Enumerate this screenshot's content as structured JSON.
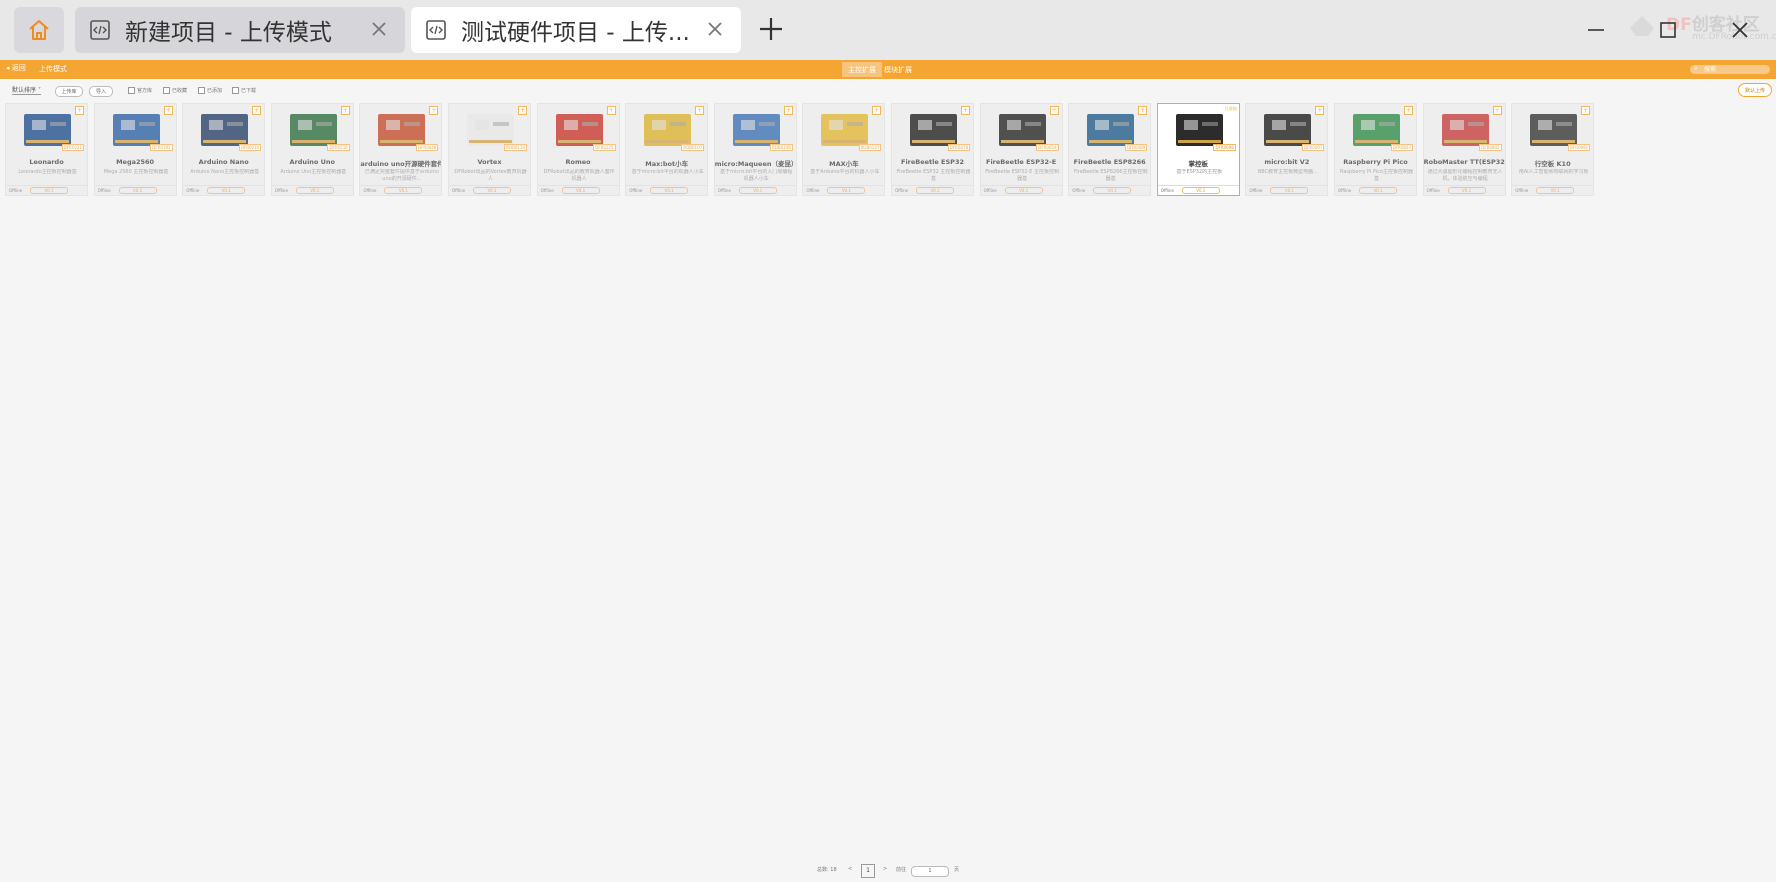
{
  "tabs": [
    {
      "label": "新建项目 - 上传模式"
    },
    {
      "label": "测试硬件项目 - 上传..."
    }
  ],
  "logo": {
    "text_df": "DF",
    "text_cn": "创客社区",
    "sub": "mc.DFRobot.com.cn"
  },
  "toolbar": {
    "back": "返回",
    "title": "上传模式",
    "tab_main": "主控扩展",
    "tab_sub": "模块扩展",
    "search_placeholder": "搜索",
    "sort_label": "默认排序",
    "btn_upload": "上传库",
    "btn_import": "导入",
    "filters": [
      "官方库",
      "已收藏",
      "已添加",
      "已下载"
    ],
    "default_upload": "默认上传"
  },
  "cards": [
    {
      "name": "Leonardo",
      "desc": "Leonardo主控板控制器基",
      "sku": "DFR0221",
      "offline": "Offline",
      "ver": "V0.1"
    },
    {
      "name": "Mega2560",
      "desc": "Mega 2560 主控板控制器基",
      "sku": "DFR0191",
      "offline": "Offline",
      "ver": "V0.1"
    },
    {
      "name": "Arduino Nano",
      "desc": "Arduino Nano主控板控制器基",
      "sku": "DFR0010",
      "offline": "Offline",
      "ver": "V0.1"
    },
    {
      "name": "Arduino Uno",
      "desc": "Arduino Uno主控板控制器基",
      "sku": "DFR0216",
      "offline": "Offline",
      "ver": "V0.1"
    },
    {
      "name": "arduino uno开源硬件套件",
      "desc": "已满足完整套件提供基于arduino uno的开源硬件...",
      "sku": "DFR0448",
      "offline": "Offline",
      "ver": "V0.1"
    },
    {
      "name": "Vortex",
      "desc": "DFRobot出品的Vortex教育机器人",
      "sku": "ROB0110",
      "offline": "Offline",
      "ver": "V0.1"
    },
    {
      "name": "Romeo",
      "desc": "DFRobot出品的教育机器人套件机器人",
      "sku": "DFR0225",
      "offline": "Offline",
      "ver": "V0.1"
    },
    {
      "name": "Max:bot小车",
      "desc": "基于micro:bit平台的机器人小车",
      "sku": "ROB0107",
      "offline": "Offline",
      "ver": "V0.1"
    },
    {
      "name": "micro:Maqueen（麦昆）",
      "desc": "基于micro:bit平台的入门级编程机器人小车",
      "sku": "ROB0148",
      "offline": "Offline",
      "ver": "V0.1"
    },
    {
      "name": "MAX小车",
      "desc": "基于Arduino平台的机器人小车",
      "sku": "ROB0137",
      "offline": "Offline",
      "ver": "V0.1"
    },
    {
      "name": "FireBeetle ESP32",
      "desc": "FireBeetle ESP32 主控板控制器基",
      "sku": "DFR0478",
      "offline": "Offline",
      "ver": "V0.1"
    },
    {
      "name": "FireBeetle ESP32-E",
      "desc": "FireBeetle ESP32-E 主控板控制器基",
      "sku": "DFR0654",
      "offline": "Offline",
      "ver": "V0.1"
    },
    {
      "name": "FireBeetle ESP8266",
      "desc": "FireBeetle ESP8266主控板控制器基",
      "sku": "DFR0489",
      "offline": "Offline",
      "ver": "V0.1"
    },
    {
      "name": "掌控板",
      "desc": "基于ESP32的主控板",
      "sku": "DFR0698",
      "offline": "Offline",
      "ver": "V0.1",
      "badge": "已添加"
    },
    {
      "name": "micro:bit V2",
      "desc": "BBC教育主控板微型电脑...",
      "sku": "DFR0497",
      "offline": "Offline",
      "ver": "V0.1"
    },
    {
      "name": "Raspberry Pi Pico",
      "desc": "Raspberry Pi Pico主控板控制器基",
      "sku": "DFR0827",
      "offline": "Offline",
      "ver": "V0.1"
    },
    {
      "name": "RoboMaster TT(ESP32)",
      "desc": "通过大疆图形化编程控制教育无人机，体验航空与编程",
      "sku": "DFR0802",
      "offline": "Offline",
      "ver": "V0.1"
    },
    {
      "name": "行空板 K10",
      "desc": "用AI人工智能和物联网的学习板",
      "sku": "DFR0992",
      "offline": "Offline",
      "ver": "V0.1"
    }
  ],
  "pager": {
    "total_label": "总数:",
    "total": "18",
    "prev": "<",
    "current": "1",
    "next": ">",
    "goto_label": "前往",
    "goto_value": "1",
    "page_unit": "页"
  }
}
